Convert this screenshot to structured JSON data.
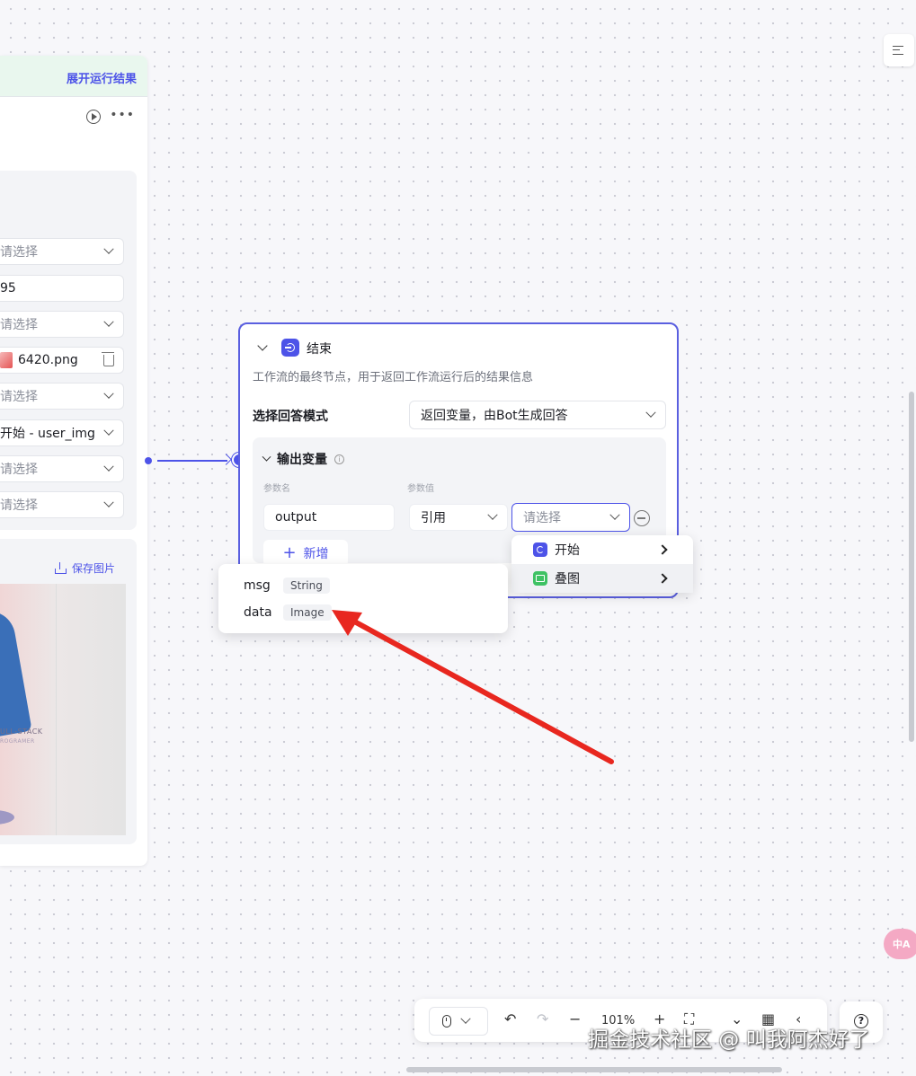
{
  "left_node": {
    "run_result_label": "展开运行结果",
    "params": [
      {
        "text": "请选择",
        "placeholder": true,
        "type": "select"
      },
      {
        "text": "95",
        "placeholder": false,
        "type": "input"
      },
      {
        "text": "请选择",
        "placeholder": true,
        "type": "select"
      },
      {
        "text": "6420.png",
        "placeholder": false,
        "type": "file"
      },
      {
        "text": "请选择",
        "placeholder": true,
        "type": "select"
      },
      {
        "text": "开始 - user_img",
        "placeholder": false,
        "type": "select"
      },
      {
        "text": "请选择",
        "placeholder": true,
        "type": "select"
      },
      {
        "text": "请选择",
        "placeholder": true,
        "type": "select"
      }
    ],
    "save_image_label": "保存图片",
    "preview_caption": "ULL-STACK",
    "preview_caption2": "ROGRAMER"
  },
  "end_node": {
    "title": "结束",
    "description": "工作流的最终节点，用于返回工作流运行后的结果信息",
    "mode_label": "选择回答模式",
    "mode_value": "返回变量，由Bot生成回答",
    "output_section_label": "输出变量",
    "col_name_label": "参数名",
    "col_value_label": "参数值",
    "output_name": "output",
    "ref_type": "引用",
    "value_placeholder": "请选择",
    "add_label": "新增"
  },
  "cascade_menu": {
    "items": [
      {
        "label": "开始",
        "icon": "start-node-icon"
      },
      {
        "label": "叠图",
        "icon": "image-overlay-icon"
      }
    ]
  },
  "variable_menu": {
    "items": [
      {
        "name": "msg",
        "type": "String"
      },
      {
        "name": "data",
        "type": "Image"
      }
    ]
  },
  "toolbar": {
    "zoom": "101%"
  },
  "translate_fab_label": "中A",
  "watermark": "掘金技术社区 @ 叫我阿杰好了",
  "colors": {
    "accent": "#4d53e8",
    "annotation_arrow": "#e8271f"
  }
}
